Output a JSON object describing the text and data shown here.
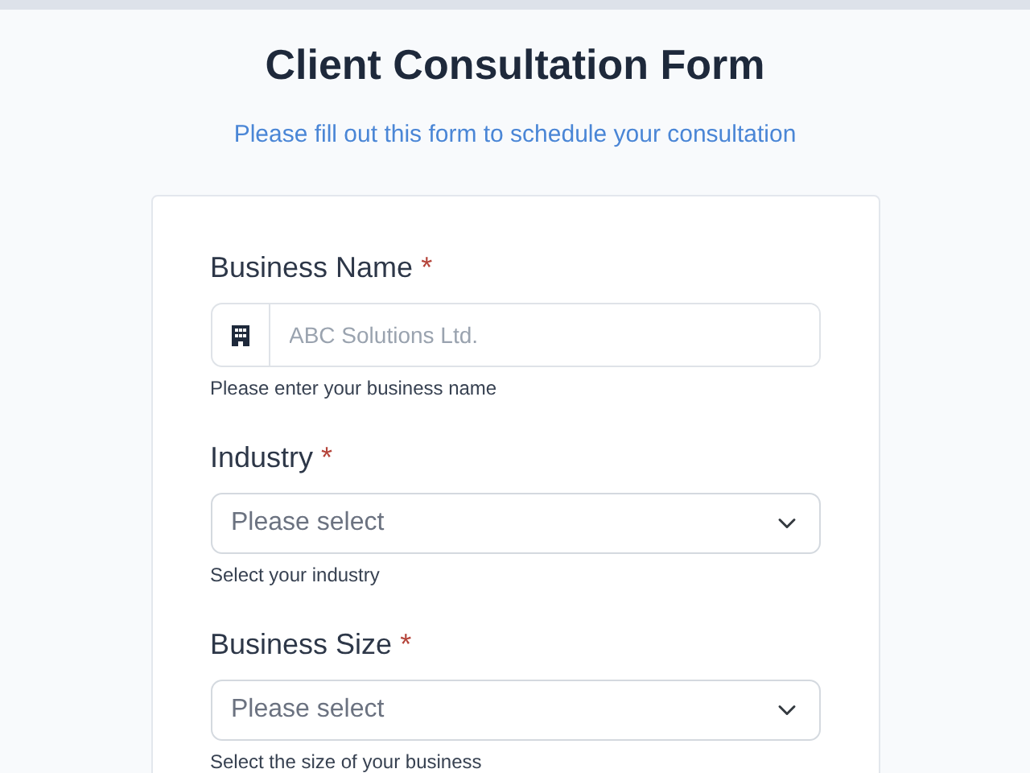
{
  "title": "Client Consultation Form",
  "subtitle": "Please fill out this form to schedule your consultation",
  "fields": [
    {
      "kind": "text",
      "label": "Business Name",
      "required_mark": "*",
      "placeholder": "ABC Solutions Ltd.",
      "help": "Please enter your business name"
    },
    {
      "kind": "select",
      "label": "Industry",
      "required_mark": "*",
      "placeholder": "Please select",
      "help": "Select your industry"
    },
    {
      "kind": "select",
      "label": "Business Size",
      "required_mark": "*",
      "placeholder": "Please select",
      "help": "Select the size of your business"
    }
  ]
}
